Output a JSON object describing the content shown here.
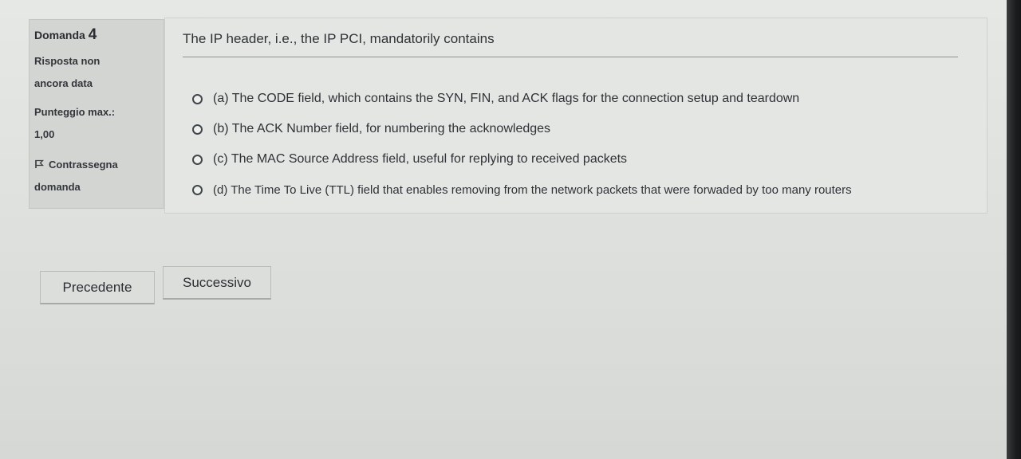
{
  "info": {
    "question_label": "Domanda",
    "question_number": "4",
    "state_line1": "Risposta non",
    "state_line2": "ancora data",
    "grade_line1": "Punteggio max.:",
    "grade_line2": "1,00",
    "flag_line1": "Contrassegna",
    "flag_line2": "domanda"
  },
  "question": {
    "text": "The IP header, i.e., the IP PCI, mandatorily contains",
    "answers": [
      "(a) The CODE field, which contains the SYN, FIN, and ACK flags for the connection setup and teardown",
      "(b) The ACK Number field, for numbering the acknowledges",
      "(c) The MAC Source Address field, useful for replying to received packets",
      "(d) The Time To Live (TTL) field that enables removing from the network packets that were forwaded by too many routers"
    ]
  },
  "navigation": {
    "previous_label": "Precedente",
    "next_label": "Successivo"
  },
  "icons": {
    "flag": "flag-icon",
    "radio": "radio-icon"
  }
}
